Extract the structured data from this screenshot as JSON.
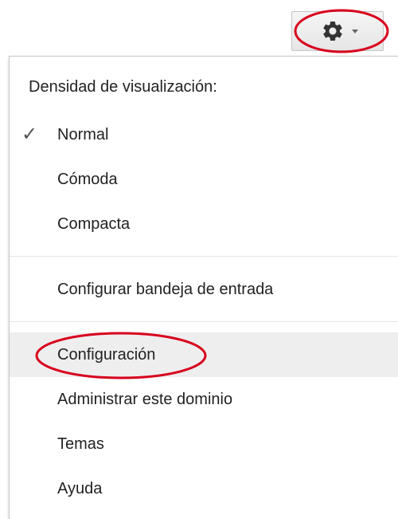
{
  "settings_button": {
    "gear_icon": "gear-icon",
    "chevron_icon": "chevron-down-icon"
  },
  "menu": {
    "density_header": "Densidad de visualización:",
    "density_options": [
      {
        "label": "Normal",
        "checked": true
      },
      {
        "label": "Cómoda",
        "checked": false
      },
      {
        "label": "Compacta",
        "checked": false
      }
    ],
    "configure_inbox": "Configurar bandeja de entrada",
    "items": [
      {
        "label": "Configuración",
        "highlighted": true
      },
      {
        "label": "Administrar este dominio",
        "highlighted": false
      },
      {
        "label": "Temas",
        "highlighted": false
      },
      {
        "label": "Ayuda",
        "highlighted": false
      }
    ],
    "check_mark": "✓"
  },
  "colors": {
    "annotation": "#d8001c",
    "hover_background": "#eeeeee",
    "text": "#222222"
  }
}
